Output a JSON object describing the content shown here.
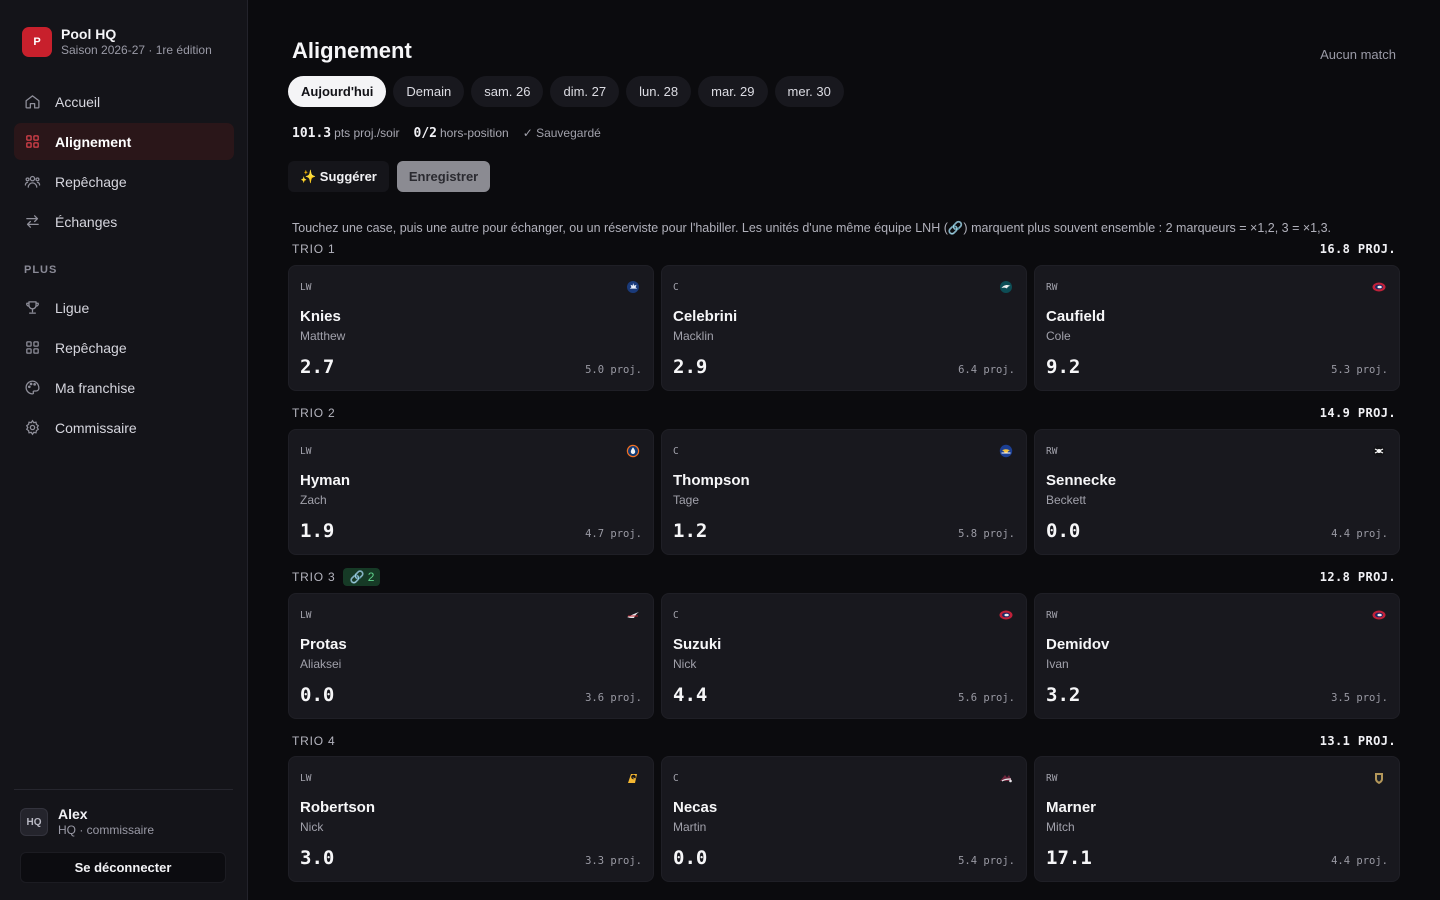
{
  "app": {
    "name": "Pool HQ",
    "season": "Saison 2026-27 · 1re édition",
    "logo_letter": "P"
  },
  "nav": {
    "main": [
      {
        "label": "Accueil",
        "icon": "home-icon"
      },
      {
        "label": "Alignement",
        "icon": "grid-icon",
        "active": true
      },
      {
        "label": "Repêchage",
        "icon": "users-icon"
      },
      {
        "label": "Échanges",
        "icon": "swap-icon"
      }
    ],
    "section_label": "PLUS",
    "more": [
      {
        "label": "Ligue",
        "icon": "trophy-icon"
      },
      {
        "label": "Repêchage",
        "icon": "grid-icon"
      },
      {
        "label": "Ma franchise",
        "icon": "palette-icon"
      },
      {
        "label": "Commissaire",
        "icon": "gear-icon"
      }
    ]
  },
  "user": {
    "initials": "HQ",
    "name": "Alex",
    "role": "HQ · commissaire",
    "logout_label": "Se déconnecter"
  },
  "header": {
    "title": "Alignement",
    "status": "Aucun match"
  },
  "days": [
    "Aujourd'hui",
    "Demain",
    "sam. 26",
    "dim. 27",
    "lun. 28",
    "mar. 29",
    "mer. 30"
  ],
  "stats": {
    "proj_value": "101.3",
    "proj_label": "pts proj./soir",
    "off_value": "0/2",
    "off_label": "hors-position",
    "saved": "✓ Sauvegardé"
  },
  "actions": {
    "suggest": "✨ Suggérer",
    "save": "Enregistrer"
  },
  "hint": "Touchez une case, puis une autre pour échanger, ou un réserviste pour l'habiller. Les unités d'une même équipe LNH (🔗) marquent plus souvent ensemble : 2 marqueurs = ×1,2, 3 = ×1,3.",
  "colors": {
    "accent": "#c8202c",
    "synergy": "#5fd18b"
  },
  "lines": [
    {
      "label": "TRIO 1",
      "proj": "16.8 PROJ.",
      "synergy": null,
      "players": [
        {
          "pos": "LW",
          "last": "Knies",
          "first": "Matthew",
          "pts": "2.7",
          "proj": "5.0 proj.",
          "team_icon": "leafs-logo-icon"
        },
        {
          "pos": "C",
          "last": "Celebrini",
          "first": "Macklin",
          "pts": "2.9",
          "proj": "6.4 proj.",
          "team_icon": "sharks-logo-icon"
        },
        {
          "pos": "RW",
          "last": "Caufield",
          "first": "Cole",
          "pts": "9.2",
          "proj": "5.3 proj.",
          "team_icon": "canadiens-logo-icon"
        }
      ]
    },
    {
      "label": "TRIO 2",
      "proj": "14.9 PROJ.",
      "synergy": null,
      "players": [
        {
          "pos": "LW",
          "last": "Hyman",
          "first": "Zach",
          "pts": "1.9",
          "proj": "4.7 proj.",
          "team_icon": "oilers-logo-icon"
        },
        {
          "pos": "C",
          "last": "Thompson",
          "first": "Tage",
          "pts": "1.2",
          "proj": "5.8 proj.",
          "team_icon": "sabres-logo-icon"
        },
        {
          "pos": "RW",
          "last": "Sennecke",
          "first": "Beckett",
          "pts": "0.0",
          "proj": "4.4 proj.",
          "team_icon": "ducks-logo-icon"
        }
      ]
    },
    {
      "label": "TRIO 3",
      "proj": "12.8 PROJ.",
      "synergy": "🔗 2",
      "players": [
        {
          "pos": "LW",
          "last": "Protas",
          "first": "Aliaksei",
          "pts": "0.0",
          "proj": "3.6 proj.",
          "team_icon": "capitals-logo-icon"
        },
        {
          "pos": "C",
          "last": "Suzuki",
          "first": "Nick",
          "pts": "4.4",
          "proj": "5.6 proj.",
          "team_icon": "canadiens-logo-icon"
        },
        {
          "pos": "RW",
          "last": "Demidov",
          "first": "Ivan",
          "pts": "3.2",
          "proj": "3.5 proj.",
          "team_icon": "canadiens-logo-icon"
        }
      ]
    },
    {
      "label": "TRIO 4",
      "proj": "13.1 PROJ.",
      "synergy": null,
      "players": [
        {
          "pos": "LW",
          "last": "Robertson",
          "first": "Nick",
          "pts": "3.0",
          "proj": "3.3 proj.",
          "team_icon": "penguins-logo-icon"
        },
        {
          "pos": "C",
          "last": "Necas",
          "first": "Martin",
          "pts": "0.0",
          "proj": "5.4 proj.",
          "team_icon": "avalanche-logo-icon"
        },
        {
          "pos": "RW",
          "last": "Marner",
          "first": "Mitch",
          "pts": "17.1",
          "proj": "4.4 proj.",
          "team_icon": "golden-knights-logo-icon"
        }
      ]
    }
  ]
}
